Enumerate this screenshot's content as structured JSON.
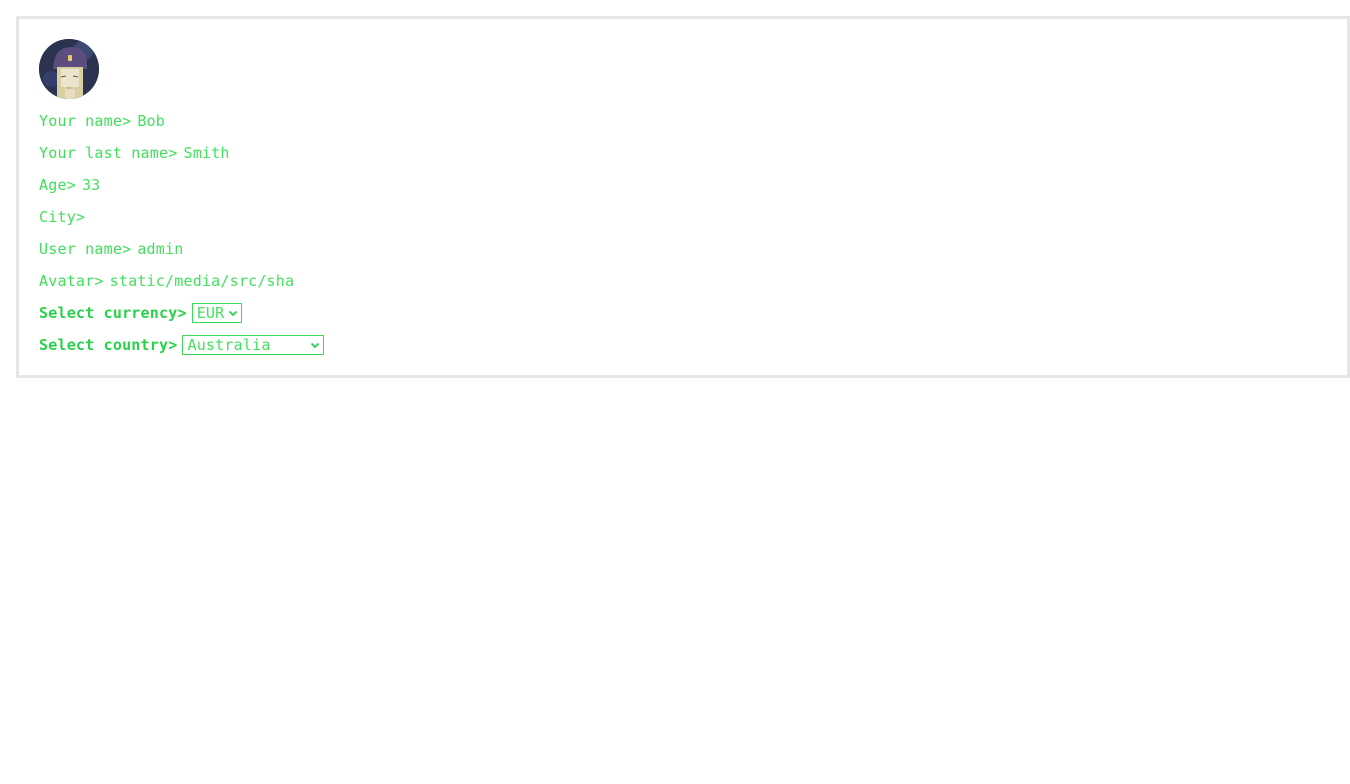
{
  "profile": {
    "fields": {
      "first_name_label": "Your name>",
      "first_name_value": "Bob",
      "last_name_label": "Your last name>",
      "last_name_value": "Smith",
      "age_label": "Age>",
      "age_value": "33",
      "city_label": "City>",
      "city_value": "",
      "username_label": "User name>",
      "username_value": "admin",
      "avatar_label": "Avatar>",
      "avatar_value": "static/media/src/sha"
    },
    "currency": {
      "label": "Select currency>",
      "selected": "EUR"
    },
    "country": {
      "label": "Select country>",
      "selected": "Australia"
    }
  },
  "colors": {
    "accent": "#3fe05a",
    "panel_border": "#e6e6e6"
  },
  "icons": {
    "avatar": "avatar-image",
    "dropdown": "chevron-down-icon"
  }
}
